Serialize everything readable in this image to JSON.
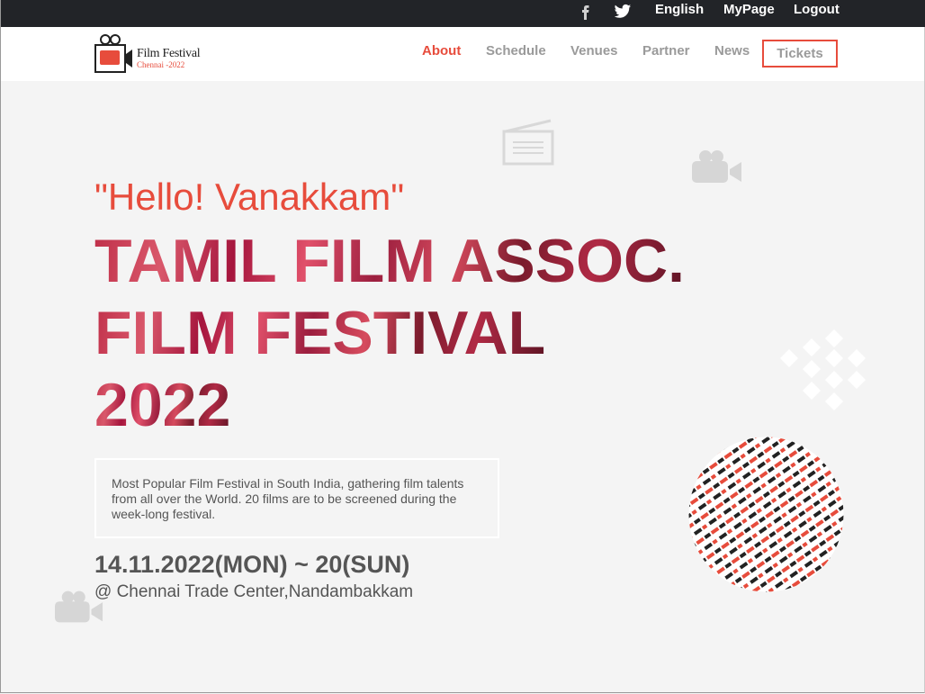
{
  "topbar": {
    "facebook_icon": "facebook-icon",
    "twitter_icon": "twitter-icon",
    "english": "English",
    "mypage": "MyPage",
    "logout": "Logout"
  },
  "header": {
    "logo_title": "Film Festival",
    "logo_sub": "Chennai -2022",
    "nav": {
      "about": "About",
      "schedule": "Schedule",
      "venues": "Venues",
      "partner": "Partner",
      "news": "News",
      "tickets": "Tickets"
    }
  },
  "hero": {
    "greeting": "\"Hello! Vanakkam\"",
    "title_lines": [
      "TAMIL FILM ASSOC.",
      "FILM FESTIVAL",
      "2022"
    ],
    "description": "Most Popular Film Festival in South India, gathering film talents from all over the World. 20 films are to be screened during the week-long festival.",
    "dates": "14.11.2022(MON) ~ 20(SUN)",
    "venue": "@ Chennai Trade Center,Nandambakkam"
  },
  "colors": {
    "accent": "#e74c3c",
    "topbar_bg": "#222428",
    "hero_bg": "#f4f4f4",
    "nav_text": "#9a9a9a"
  }
}
